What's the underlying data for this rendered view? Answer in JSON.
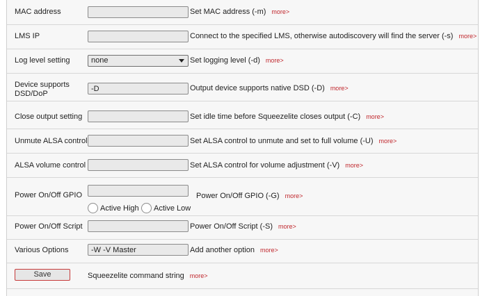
{
  "more_label": "more>",
  "rows": {
    "mac": {
      "label": "MAC address",
      "value": "",
      "desc": "Set MAC address (-m)"
    },
    "lms": {
      "label": "LMS IP",
      "value": "",
      "desc": "Connect to the specified LMS, otherwise autodiscovery will find the server (-s)"
    },
    "log": {
      "label": "Log level setting",
      "value": "none",
      "desc": "Set logging level (-d)"
    },
    "dsd": {
      "label": "Device supports DSD/DoP",
      "value": "-D",
      "desc": "Output device supports native DSD (-D)"
    },
    "close": {
      "label": "Close output setting",
      "value": "",
      "desc": "Set idle time before Squeezelite closes output (-C)"
    },
    "unmute": {
      "label": "Unmute ALSA control",
      "value": "",
      "desc": "Set ALSA control to unmute and set to full volume (-U)"
    },
    "volume": {
      "label": "ALSA volume control",
      "value": "",
      "desc": "Set ALSA control for volume adjustment (-V)"
    },
    "gpio": {
      "label": "Power On/Off GPIO",
      "value": "",
      "desc": "Power On/Off GPIO (-G)",
      "radio_high": "Active High",
      "radio_low": "Active Low"
    },
    "script": {
      "label": "Power On/Off Script",
      "value": "",
      "desc": "Power On/Off Script (-S)"
    },
    "options": {
      "label": "Various Options",
      "value": "-W -V Master",
      "desc": "Add another option"
    }
  },
  "save": {
    "label": "Save",
    "desc": "Squeezelite command string"
  },
  "colors": {
    "more_link": "#c0272d",
    "save_border": "#c63a3a",
    "panel_bg": "#f7f7f7",
    "field_bg": "#e9e9e9"
  }
}
